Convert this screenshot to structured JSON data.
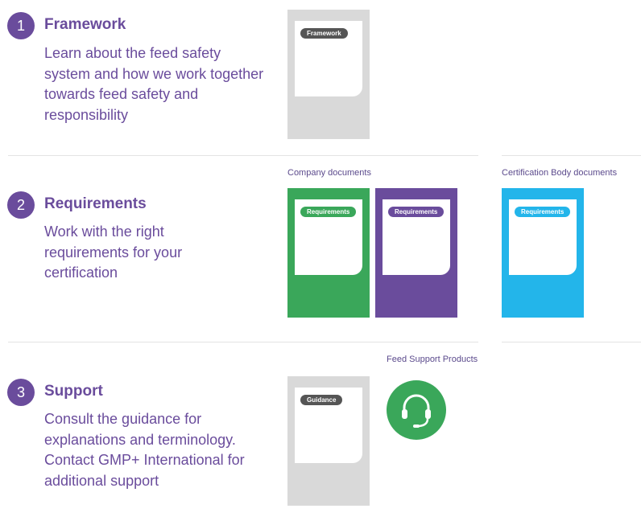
{
  "steps": [
    {
      "number": "1",
      "title": "Framework",
      "description": "Learn about the feed safety system and how we work together towards feed safety and responsibility"
    },
    {
      "number": "2",
      "title": "Requirements",
      "description": "Work with the right requirements for your certification"
    },
    {
      "number": "3",
      "title": "Support",
      "description": "Consult the guidance for explanations and terminology. Contact GMP+ International for additional support"
    }
  ],
  "labels": {
    "company_documents": "Company documents",
    "certification_body_documents": "Certification Body documents",
    "feed_support_products": "Feed Support Products"
  },
  "cards": {
    "framework": {
      "tag": "Framework",
      "color": "#d9d9d9",
      "tag_color": "#555555"
    },
    "company_req_green": {
      "tag": "Requirements",
      "color": "#3aa75a",
      "tag_color": "#3aa75a"
    },
    "company_req_purple": {
      "tag": "Requirements",
      "color": "#6a4c9c",
      "tag_color": "#6a4c9c"
    },
    "cb_req_blue": {
      "tag": "Requirements",
      "color": "#23b5ea",
      "tag_color": "#23b5ea"
    },
    "guidance": {
      "tag": "Guidance",
      "color": "#d9d9d9",
      "tag_color": "#555555"
    }
  },
  "support_icon": {
    "name": "headset-icon",
    "color": "#3aa75a"
  }
}
